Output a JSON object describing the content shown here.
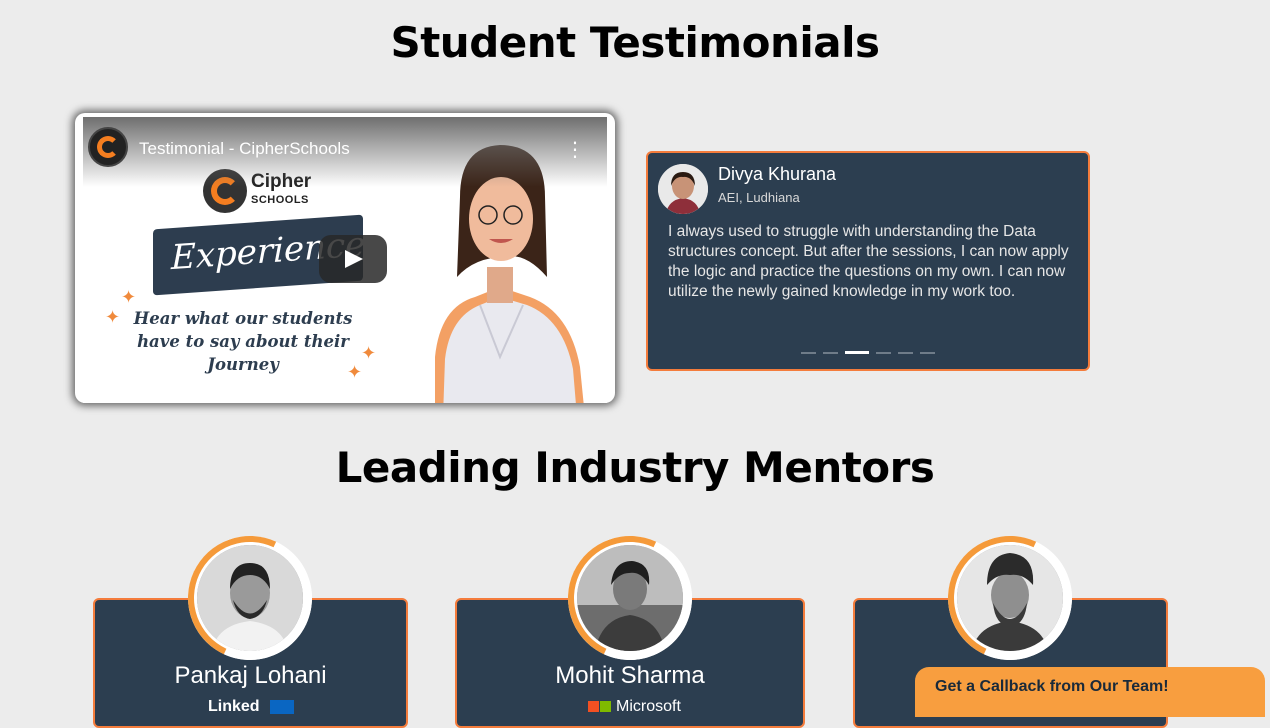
{
  "sections": {
    "testimonials_title": "Student Testimonials",
    "mentors_title": "Leading Industry Mentors"
  },
  "video": {
    "title": "Testimonial - CipherSchools",
    "logo_line1": "Cipher",
    "logo_line2": "SCHOOLS",
    "banner_text": "Experiences!",
    "subtitle": "Hear what our students have to say about their Journey"
  },
  "testimonial": {
    "name": "Divya Khurana",
    "role": "AEI, Ludhiana",
    "text": "I always used to struggle with understanding the Data structures concept. But after the sessions, I can now apply the logic and practice the questions on my own. I can now utilize the newly gained knowledge in my work too.",
    "slides_total": 6,
    "active_slide": 3
  },
  "mentors": [
    {
      "name": "Pankaj Lohani",
      "company": "LinkedIn"
    },
    {
      "name": "Mohit Sharma",
      "company": "Microsoft"
    },
    {
      "name": "",
      "company": ""
    }
  ],
  "callback": {
    "label": "Get a Callback from Our Team!"
  },
  "colors": {
    "card_bg": "#2c3e50",
    "accent": "#f47c3c",
    "callback_bg": "#f89e3f",
    "page_bg": "#ececec"
  }
}
